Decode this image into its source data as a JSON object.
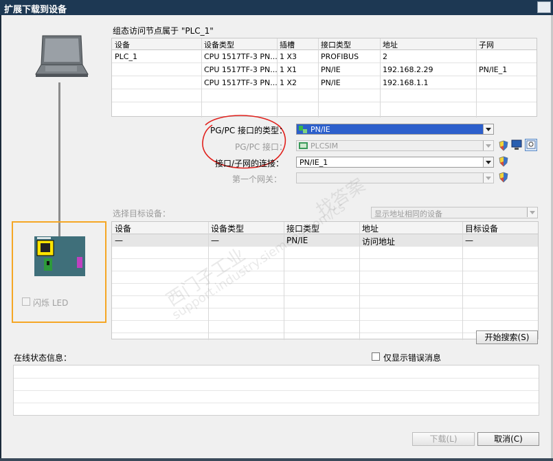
{
  "window": {
    "title": "扩展下载到设备"
  },
  "config_header": "组态访问节点属于 \"PLC_1\"",
  "config_table": {
    "columns": [
      "设备",
      "设备类型",
      "插槽",
      "接口类型",
      "地址",
      "子网"
    ],
    "rows": [
      [
        "PLC_1",
        "CPU 1517TF-3 PN...",
        "1 X3",
        "PROFIBUS",
        "2",
        ""
      ],
      [
        "",
        "CPU 1517TF-3 PN...",
        "1 X1",
        "PN/IE",
        "192.168.2.29",
        "PN/IE_1"
      ],
      [
        "",
        "CPU 1517TF-3 PN...",
        "1 X2",
        "PN/IE",
        "192.168.1.1",
        ""
      ]
    ]
  },
  "interface_settings": {
    "pgpc_type_label": "PG/PC 接口的类型：",
    "pgpc_type_value": "PN/IE",
    "pgpc_iface_label": "PG/PC 接口：",
    "pgpc_iface_value": "PLCSIM",
    "subnet_conn_label": "接口/子网的连接：",
    "subnet_conn_value": "PN/IE_1",
    "gateway_label": "第一个网关：",
    "gateway_value": ""
  },
  "target": {
    "select_label": "选择目标设备：",
    "filter_value": "显示地址相同的设备",
    "columns": [
      "设备",
      "设备类型",
      "接口类型",
      "地址",
      "目标设备"
    ],
    "rows": [
      [
        "—",
        "—",
        "PN/IE",
        "访问地址",
        "—"
      ]
    ]
  },
  "flash_led_label": "闪烁 LED",
  "start_search_button": "开始搜索(S)",
  "online_status_label": "在线状态信息：",
  "only_errors_label": "仅显示错误消息",
  "load_button": "下载(L)",
  "cancel_button": "取消(C)",
  "watermark": {
    "cn1": "西门子工业",
    "cn2": "找答案",
    "url": "support.industry.siemens.com/cs"
  },
  "colors": {
    "titlebar": "#1d3853",
    "highlight_orange": "#f5a623",
    "annotation_red": "#e0201c",
    "selection_blue": "#2c5fcc",
    "plc_teal": "#3f6f7a"
  }
}
